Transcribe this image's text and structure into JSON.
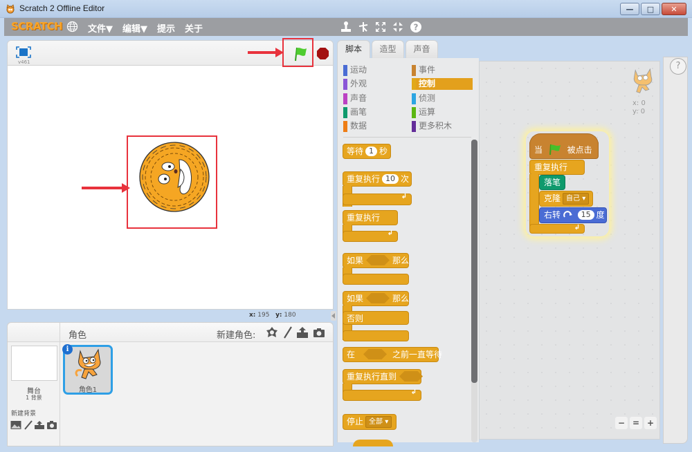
{
  "window": {
    "title": "Scratch 2 Offline Editor",
    "controls": {
      "minimize": "—",
      "maximize": "□",
      "close": "✕"
    }
  },
  "menubar": {
    "logo": "SCRATCH",
    "items": [
      "文件▼",
      "编辑▼",
      "提示",
      "关于"
    ],
    "tools": [
      {
        "name": "duplicate-stamp-icon",
        "glyph": "⊥"
      },
      {
        "name": "delete-scissors-icon",
        "glyph": "✂"
      },
      {
        "name": "grow-icon",
        "glyph": "⤧"
      },
      {
        "name": "shrink-icon",
        "glyph": "⤨"
      },
      {
        "name": "help-icon",
        "glyph": "?"
      }
    ]
  },
  "stage": {
    "version": "v461",
    "mouse_x_label": "x:",
    "mouse_x": "195",
    "mouse_y_label": "y:",
    "mouse_y": "180"
  },
  "tabs": [
    {
      "label": "脚本",
      "active": true
    },
    {
      "label": "造型",
      "active": false
    },
    {
      "label": "声音",
      "active": false
    }
  ],
  "categories": {
    "left": [
      {
        "label": "运动",
        "color": "#4a6cd4"
      },
      {
        "label": "外观",
        "color": "#8a55d7"
      },
      {
        "label": "声音",
        "color": "#bb42c3"
      },
      {
        "label": "画笔",
        "color": "#0e9a6c"
      },
      {
        "label": "数据",
        "color": "#ee7d16"
      }
    ],
    "right": [
      {
        "label": "事件",
        "color": "#c88330",
        "selected": false
      },
      {
        "label": "控制",
        "color": "#e1a91a",
        "selected": true
      },
      {
        "label": "侦测",
        "color": "#2ca5e2",
        "selected": false
      },
      {
        "label": "运算",
        "color": "#5cb712",
        "selected": false
      },
      {
        "label": "更多积木",
        "color": "#632d99",
        "selected": false
      }
    ]
  },
  "palette_blocks": {
    "wait": {
      "pre": "等待",
      "value": "1",
      "post": "秒"
    },
    "repeat": {
      "pre": "重复执行",
      "value": "10",
      "post": "次"
    },
    "forever": {
      "label": "重复执行"
    },
    "if_then": {
      "pre": "如果",
      "post": "那么"
    },
    "if_else": {
      "pre": "如果",
      "post": "那么",
      "else": "否则"
    },
    "wait_until": {
      "pre": "在",
      "post": "之前一直等待"
    },
    "repeat_until": {
      "label": "重复执行直到"
    },
    "stop": {
      "label": "停止",
      "option": "全部"
    },
    "loop_arrow": "↲"
  },
  "script": {
    "hat": {
      "pre": "当",
      "post": "被点击"
    },
    "forever": "重复执行",
    "pen_down": "落笔",
    "clone": {
      "label": "克隆",
      "option": "自己"
    },
    "turn": {
      "pre": "右转",
      "value": "15",
      "post": "度"
    }
  },
  "script_area": {
    "sprite_x": "x: 0",
    "sprite_y": "y: 0",
    "help": "?",
    "zoom_out": "−",
    "zoom_reset": "=",
    "zoom_in": "+"
  },
  "sprites": {
    "header": "角色",
    "new_sprite_label": "新建角色:",
    "stage_label": "舞台",
    "backdrop_count": "1 背景",
    "new_backdrop_label": "新建背景",
    "items": [
      {
        "name": "角色1",
        "info": "i"
      }
    ]
  }
}
